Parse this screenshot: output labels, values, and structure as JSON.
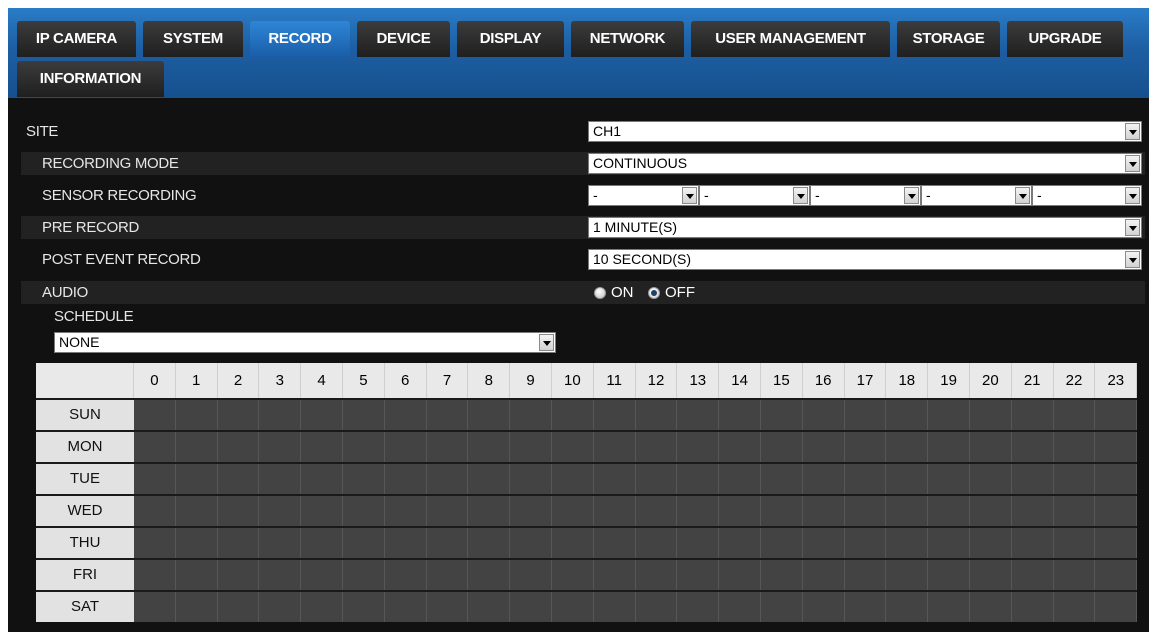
{
  "tabs": [
    {
      "label": "IP CAMERA",
      "active": false
    },
    {
      "label": "SYSTEM",
      "active": false
    },
    {
      "label": "RECORD",
      "active": true
    },
    {
      "label": "DEVICE",
      "active": false
    },
    {
      "label": "DISPLAY",
      "active": false
    },
    {
      "label": "NETWORK",
      "active": false
    },
    {
      "label": "USER MANAGEMENT",
      "active": false
    },
    {
      "label": "STORAGE",
      "active": false
    },
    {
      "label": "UPGRADE",
      "active": false
    },
    {
      "label": "INFORMATION",
      "active": false
    }
  ],
  "form": {
    "site": {
      "label": "SITE",
      "value": "CH1"
    },
    "recording_mode": {
      "label": "RECORDING MODE",
      "value": "CONTINUOUS"
    },
    "sensor_recording": {
      "label": "SENSOR RECORDING",
      "values": [
        "-",
        "-",
        "-",
        "-",
        "-"
      ]
    },
    "pre_record": {
      "label": "PRE RECORD",
      "value": "1 MINUTE(S)"
    },
    "post_event_record": {
      "label": "POST EVENT RECORD",
      "value": "10 SECOND(S)"
    },
    "audio": {
      "label": "AUDIO",
      "on_label": "ON",
      "off_label": "OFF",
      "selected": "OFF"
    },
    "schedule": {
      "label": "SCHEDULE",
      "value": "NONE"
    }
  },
  "grid": {
    "hours": [
      "0",
      "1",
      "2",
      "3",
      "4",
      "5",
      "6",
      "7",
      "8",
      "9",
      "10",
      "11",
      "12",
      "13",
      "14",
      "15",
      "16",
      "17",
      "18",
      "19",
      "20",
      "21",
      "22",
      "23"
    ],
    "days": [
      "SUN",
      "MON",
      "TUE",
      "WED",
      "THU",
      "FRI",
      "SAT"
    ]
  },
  "colors": {
    "active_tab": "#2e86d6",
    "tab_bar": "#1d5fa3",
    "background": "#111111",
    "grid_slot": "#434343"
  }
}
